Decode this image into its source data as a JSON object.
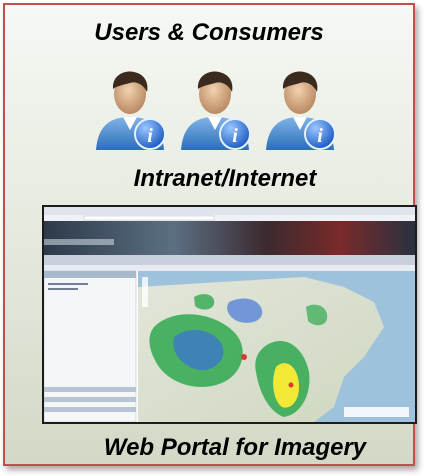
{
  "panel": {
    "title_top": "Users & Consumers",
    "title_mid": "Intranet/Internet",
    "title_bottom": "Web Portal for Imagery"
  },
  "users": [
    {
      "icon": "user-info-icon"
    },
    {
      "icon": "user-info-icon"
    },
    {
      "icon": "user-info-icon"
    }
  ],
  "colors": {
    "panel_border": "#c0504d",
    "avatar_shirt": "#3a7fc8",
    "info_badge": "#2a6fd0",
    "radar_green": "#2fa84f",
    "radar_yellow": "#f2e836"
  }
}
